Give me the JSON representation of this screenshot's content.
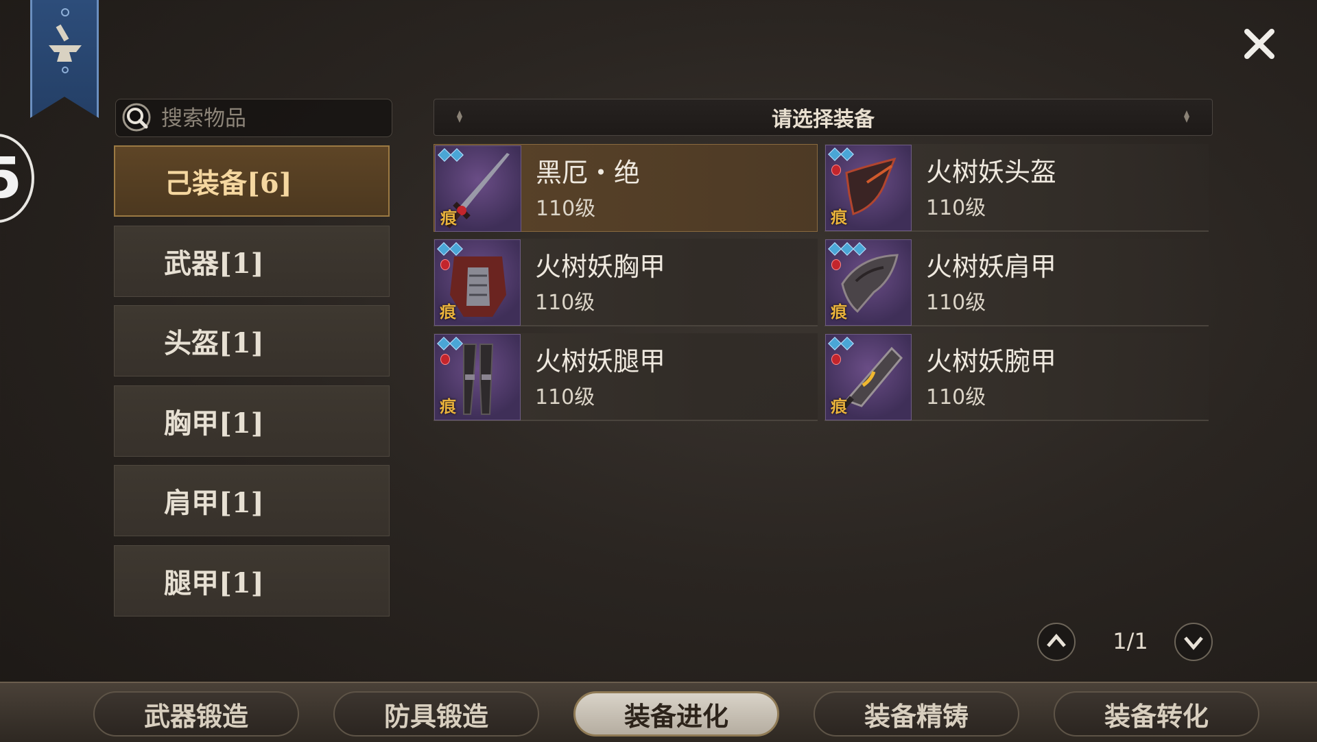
{
  "search": {
    "placeholder": "搜索物品"
  },
  "categories": [
    {
      "label": "己装备[6]",
      "active": true
    },
    {
      "label": "武器[1]"
    },
    {
      "label": "头盔[1]"
    },
    {
      "label": "胸甲[1]"
    },
    {
      "label": "肩甲[1]"
    },
    {
      "label": "腿甲[1]"
    }
  ],
  "level_badge": "5",
  "header": {
    "title": "请选择装备"
  },
  "items": [
    {
      "name": "黑厄・绝",
      "level": "110级",
      "mark": "痕",
      "selected": true,
      "icon": "sword-icon"
    },
    {
      "name": "火树妖头盔",
      "level": "110级",
      "mark": "痕",
      "icon": "helmet-icon"
    },
    {
      "name": "火树妖胸甲",
      "level": "110级",
      "mark": "痕",
      "icon": "chest-armor-icon"
    },
    {
      "name": "火树妖肩甲",
      "level": "110级",
      "mark": "痕",
      "icon": "shoulder-armor-icon"
    },
    {
      "name": "火树妖腿甲",
      "level": "110级",
      "mark": "痕",
      "icon": "leg-armor-icon"
    },
    {
      "name": "火树妖腕甲",
      "level": "110级",
      "mark": "痕",
      "icon": "bracer-icon"
    }
  ],
  "pager": {
    "text": "1/1"
  },
  "tabs": [
    {
      "label": "武器锻造"
    },
    {
      "label": "防具锻造"
    },
    {
      "label": "装备进化",
      "active": true
    },
    {
      "label": "装备精铸"
    },
    {
      "label": "装备转化"
    }
  ],
  "colors": {
    "accent": "#9c7a43",
    "gem": "#4aa6d6",
    "ruby": "#c3252c",
    "mark": "#e9b23c"
  }
}
